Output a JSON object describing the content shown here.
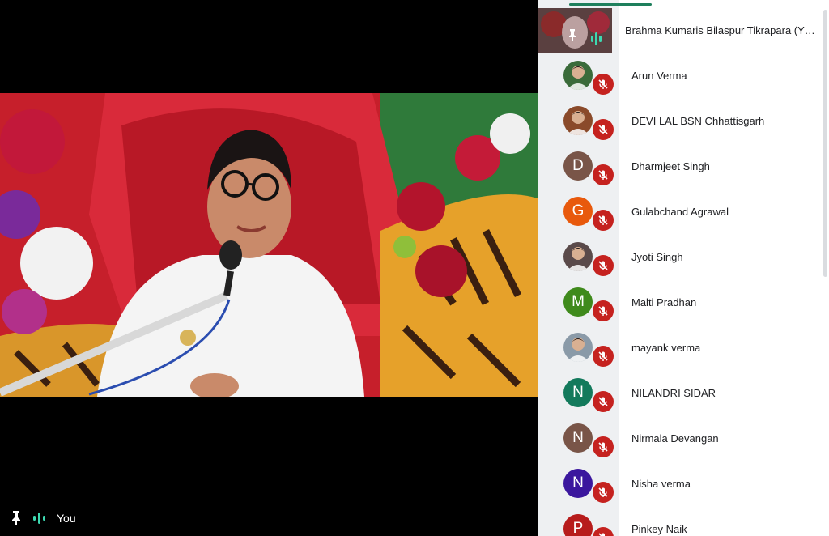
{
  "stage": {
    "self_label": "You"
  },
  "presenter": {
    "name": "Brahma Kumaris Bilaspur Tikrapara (Y…"
  },
  "participants": [
    {
      "name": "Arun Verma",
      "initial": "",
      "color": "#3a6b3a",
      "photo": true
    },
    {
      "name": "DEVI LAL BSN Chhattisgarh",
      "initial": "",
      "color": "#8a4a2a",
      "photo": true
    },
    {
      "name": "Dharmjeet Singh",
      "initial": "D",
      "color": "#795548",
      "photo": false
    },
    {
      "name": "Gulabchand Agrawal",
      "initial": "G",
      "color": "#e8590c",
      "photo": false
    },
    {
      "name": "Jyoti Singh",
      "initial": "",
      "color": "#5a4a4a",
      "photo": true
    },
    {
      "name": "Malti Pradhan",
      "initial": "M",
      "color": "#3f8a1c",
      "photo": false
    },
    {
      "name": "mayank verma",
      "initial": "",
      "color": "#8a9aa8",
      "photo": true
    },
    {
      "name": "NILANDRI SIDAR",
      "initial": "N",
      "color": "#137a5c",
      "photo": false
    },
    {
      "name": "Nirmala Devangan",
      "initial": "N",
      "color": "#795548",
      "photo": false
    },
    {
      "name": "Nisha verma",
      "initial": "N",
      "color": "#3b179e",
      "photo": false
    },
    {
      "name": "Pinkey Naik",
      "initial": "P",
      "color": "#b71c1c",
      "photo": false
    }
  ]
}
